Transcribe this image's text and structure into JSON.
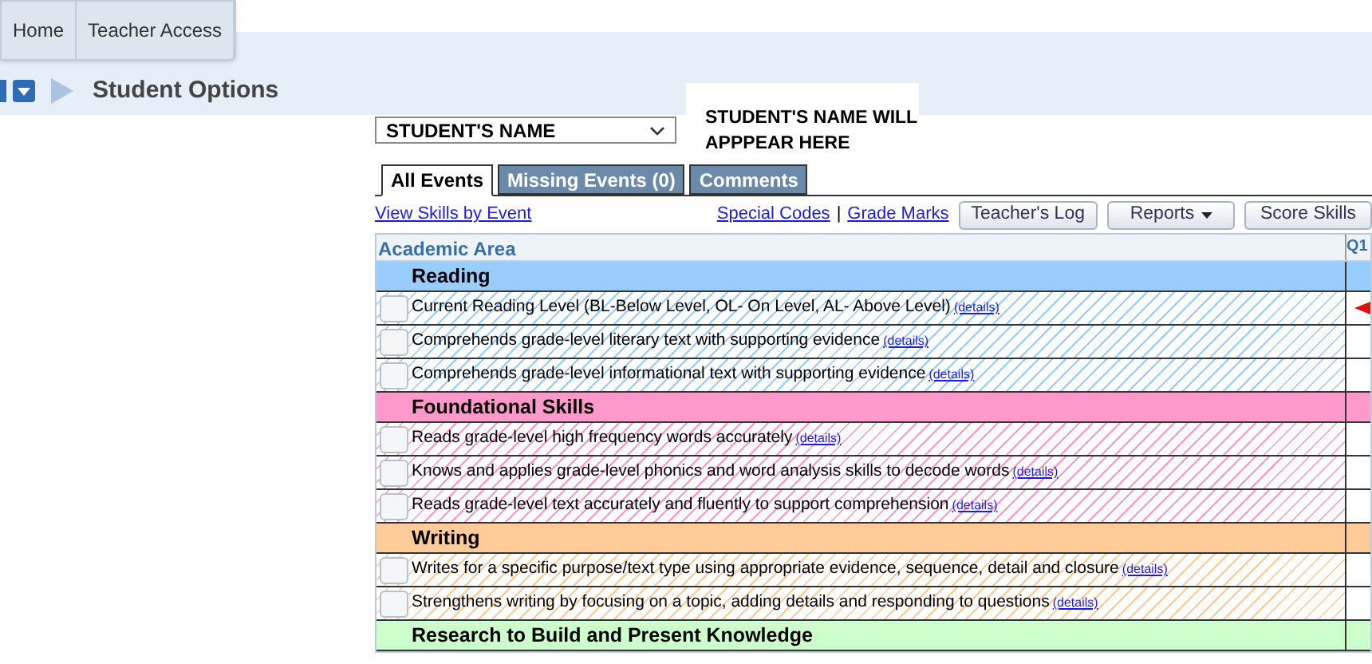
{
  "nav_tabs": [
    {
      "label": "Home"
    },
    {
      "label": "Teacher Access"
    }
  ],
  "page_title": "Student Options",
  "student_select": {
    "value": "STUDENT'S NAME"
  },
  "student_note": "STUDENT'S NAME WILL APPPEAR HERE",
  "tabs": [
    {
      "label": "All Events",
      "selected": true
    },
    {
      "label": "Missing Events (0)",
      "selected": false
    },
    {
      "label": "Comments",
      "selected": false
    }
  ],
  "links": {
    "left": "View Skills by Event",
    "right": [
      "Special Codes",
      "Grade Marks"
    ],
    "separator": "|"
  },
  "buttons": [
    {
      "label": "Teacher's Log",
      "dropdown": false
    },
    {
      "label": "Reports",
      "dropdown": true
    },
    {
      "label": "Score Skills",
      "dropdown": false
    }
  ],
  "table": {
    "columns": [
      "Academic Area",
      "Q1"
    ],
    "sections": [
      {
        "title": "Reading",
        "color": "#99ccff",
        "skills": [
          {
            "text": "Current Reading Level (BL-Below Level, OL- On Level, AL- Above Level)",
            "link": "(details)",
            "checked": false,
            "flag": true
          },
          {
            "text": "Comprehends grade-level literary text with supporting evidence",
            "link": "(details)",
            "checked": false,
            "flag": false
          },
          {
            "text": "Comprehends grade-level informational text with supporting evidence",
            "link": "(details)",
            "checked": false,
            "flag": false
          }
        ]
      },
      {
        "title": "Foundational Skills",
        "color": "#ff99cc",
        "skills": [
          {
            "text": "Reads grade-level high frequency words accurately",
            "link": "(details)",
            "checked": false,
            "flag": false
          },
          {
            "text": "Knows and applies grade-level phonics and word analysis skills to decode words",
            "link": "(details)",
            "checked": false,
            "flag": false
          },
          {
            "text": "Reads grade-level text accurately and fluently to support comprehension",
            "link": "(details)",
            "checked": false,
            "flag": false
          }
        ]
      },
      {
        "title": "Writing",
        "color": "#ffcc99",
        "skills": [
          {
            "text": "Writes for a specific purpose/text type using appropriate evidence, sequence, detail and closure",
            "link": "(details)",
            "checked": false,
            "flag": false
          },
          {
            "text": "Strengthens writing by focusing on a topic, adding details and responding to questions",
            "link": "(details)",
            "checked": false,
            "flag": false
          }
        ]
      },
      {
        "title": "Research to Build and Present Knowledge",
        "color": "#ccffcc"
      }
    ]
  }
}
